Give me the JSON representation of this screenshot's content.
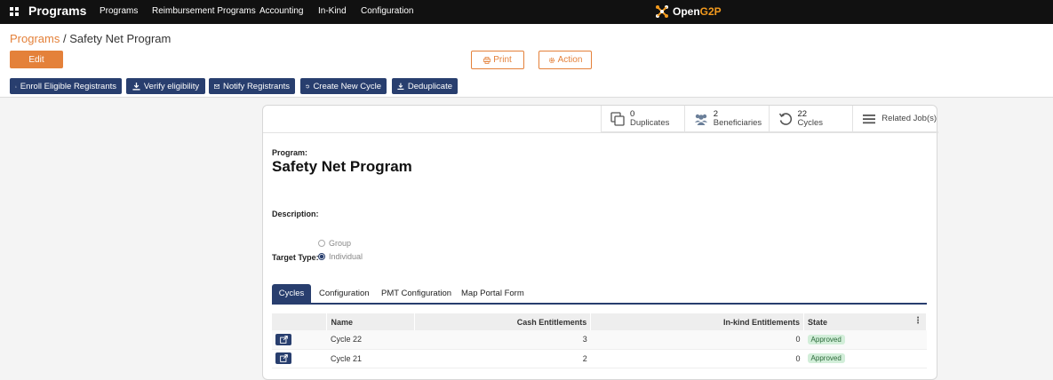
{
  "navbar": {
    "title": "Programs",
    "menus": [
      "Programs",
      "Reimbursement Programs",
      "Accounting",
      "In-Kind",
      "Configuration"
    ],
    "brand": {
      "name_primary": "Open",
      "name_accent": "G2P",
      "accent_color": "#f29a1e"
    }
  },
  "breadcrumb": {
    "parent": "Programs",
    "separator": " / ",
    "current": "Safety Net Program"
  },
  "toolbar": {
    "edit_label": "Edit",
    "print_label": "Print",
    "action_label": "Action",
    "accent_color": "#e4813a"
  },
  "header_buttons": [
    "Enroll Eligible Registrants",
    "Verify eligibility",
    "Notify Registrants",
    "Create New Cycle",
    "Deduplicate"
  ],
  "stat_buttons": {
    "duplicates": {
      "value": "0",
      "label": "Duplicates"
    },
    "beneficiaries": {
      "value": "2",
      "label": "Beneficiaries"
    },
    "cycles": {
      "value": "22",
      "label": "Cycles"
    },
    "jobs": {
      "label": "Related Job(s)"
    }
  },
  "form": {
    "program_label": "Program:",
    "program_name": "Safety Net Program",
    "description_label": "Description:",
    "target_type_label": "Target Type:",
    "target_options": [
      "Group",
      "Individual"
    ],
    "target_selected": "Individual"
  },
  "tabs": [
    "Cycles",
    "Configuration",
    "PMT Configuration",
    "Map Portal Form"
  ],
  "table": {
    "headers": [
      "Name",
      "Cash Entitlements",
      "In-kind Entitlements",
      "State"
    ],
    "rows": [
      {
        "name": "Cycle 22",
        "cash": "3",
        "inkind": "0",
        "state": "Approved"
      },
      {
        "name": "Cycle 21",
        "cash": "2",
        "inkind": "0",
        "state": "Approved"
      }
    ]
  },
  "colors": {
    "primary": "#283e6e",
    "accent": "#e4813a",
    "navbar": "#111111"
  }
}
